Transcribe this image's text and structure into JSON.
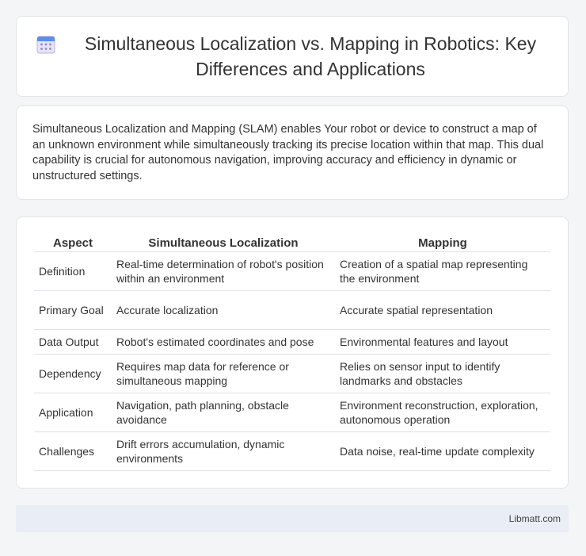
{
  "header": {
    "icon": "calendar-icon",
    "title": "Simultaneous Localization vs. Mapping in Robotics: Key Differences and Applications"
  },
  "intro": {
    "text": "Simultaneous Localization and Mapping (SLAM) enables Your robot or device to construct a map of an unknown environment while simultaneously tracking its precise location within that map. This dual capability is crucial for autonomous navigation, improving accuracy and efficiency in dynamic or unstructured settings."
  },
  "table": {
    "headers": [
      "Aspect",
      "Simultaneous Localization",
      "Mapping"
    ],
    "rows": [
      {
        "aspect": "Definition",
        "localization": "Real-time determination of robot's position within an environment",
        "mapping": "Creation of a spatial map representing the environment"
      },
      {
        "aspect": "Primary Goal",
        "localization": "Accurate localization",
        "mapping": "Accurate spatial representation"
      },
      {
        "aspect": "Data Output",
        "localization": "Robot's estimated coordinates and pose",
        "mapping": "Environmental features and layout"
      },
      {
        "aspect": "Dependency",
        "localization": "Requires map data for reference or simultaneous mapping",
        "mapping": "Relies on sensor input to identify landmarks and obstacles"
      },
      {
        "aspect": "Application",
        "localization": "Navigation, path planning, obstacle avoidance",
        "mapping": "Environment reconstruction, exploration, autonomous operation"
      },
      {
        "aspect": "Challenges",
        "localization": "Drift errors accumulation, dynamic environments",
        "mapping": "Data noise, real-time update complexity"
      }
    ]
  },
  "footer": {
    "brand": "Libmatt.com"
  }
}
